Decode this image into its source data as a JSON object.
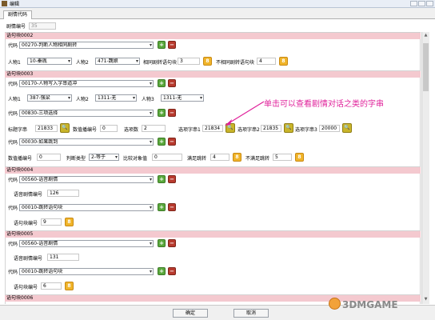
{
  "window": {
    "title": "编辑"
  },
  "tabs": [
    {
      "label": "剧情代码"
    }
  ],
  "header": {
    "id_label": "剧情编号",
    "id_value": "35"
  },
  "icons": {
    "add": "+",
    "delete": "−",
    "link": "8",
    "lookup": "🔍"
  },
  "annotation": "单击可以查看剧情对话之类的字串",
  "blocks": [
    {
      "title": "语句块0002",
      "code_label": "代码",
      "code_value": "00270-判断人物相同剧转",
      "fields": {
        "char1_label": "人物1",
        "char1_value": "10-秦胤",
        "char2_label": "人物2",
        "char2_value": "471-魏娘",
        "same_label": "相同剧转语句块",
        "same_value": "3",
        "notsame_label": "不相同剧转语句块",
        "notsame_value": "4"
      }
    },
    {
      "title": "语句块0003",
      "entries": [
        {
          "code_label": "代码",
          "code_value": "00170-人物写入字串道冲",
          "fields": {
            "char1_label": "人物1",
            "char1_value": "387-强梁",
            "char2_label": "人物2",
            "char2_value": "1311-无",
            "char3_label": "人物3",
            "char3_value": "1311-无"
          }
        },
        {
          "code_label": "代码",
          "code_value": "00830-三项选择",
          "fields": {
            "title_label": "标题字串",
            "title_value": "21833",
            "var_label": "数值播编号",
            "var_value": "0",
            "count_label": "选项数",
            "count_value": "2",
            "opt1_label": "选项字串1",
            "opt1_value": "21834",
            "opt2_label": "选项字串2",
            "opt2_value": "21835",
            "opt3_label": "选项字串3",
            "opt3_value": "20000"
          }
        },
        {
          "code_label": "代码",
          "code_value": "00030-如果跳到",
          "fields": {
            "var_label": "数值播编号",
            "var_value": "0",
            "judge_label": "判断类型",
            "judge_value": "2-等于",
            "cmp_label": "比较对象值",
            "cmp_value": "0",
            "meet_label": "满足跳转",
            "meet_value": "4",
            "notmeet_label": "不满足跳转",
            "notmeet_value": "5"
          }
        }
      ]
    },
    {
      "title": "语句块0004",
      "entries": [
        {
          "code_label": "代码",
          "code_value": "00560-语音剧情",
          "fields": {
            "voice_label": "语音剧情编号",
            "voice_value": "126"
          }
        },
        {
          "code_label": "代码",
          "code_value": "00010-跳转语句块",
          "fields": {
            "jump_label": "语句块编号",
            "jump_value": "9"
          }
        }
      ]
    },
    {
      "title": "语句块0005",
      "entries": [
        {
          "code_label": "代码",
          "code_value": "00560-语音剧情",
          "fields": {
            "voice_label": "语音剧情编号",
            "voice_value": "131"
          }
        },
        {
          "code_label": "代码",
          "code_value": "00010-跳转语句块",
          "fields": {
            "jump_label": "语句块编号",
            "jump_value": "6"
          }
        }
      ]
    },
    {
      "title": "语句块0006"
    }
  ],
  "footer": {
    "ok_label": "确定",
    "cancel_label": "取消"
  },
  "watermark": "3DMGAME",
  "colors": {
    "block_header": "#f4c9cf",
    "annotation": "#e0229b",
    "add": "#5aa83c",
    "delete": "#b83a2e",
    "link": "#f0b42a"
  }
}
